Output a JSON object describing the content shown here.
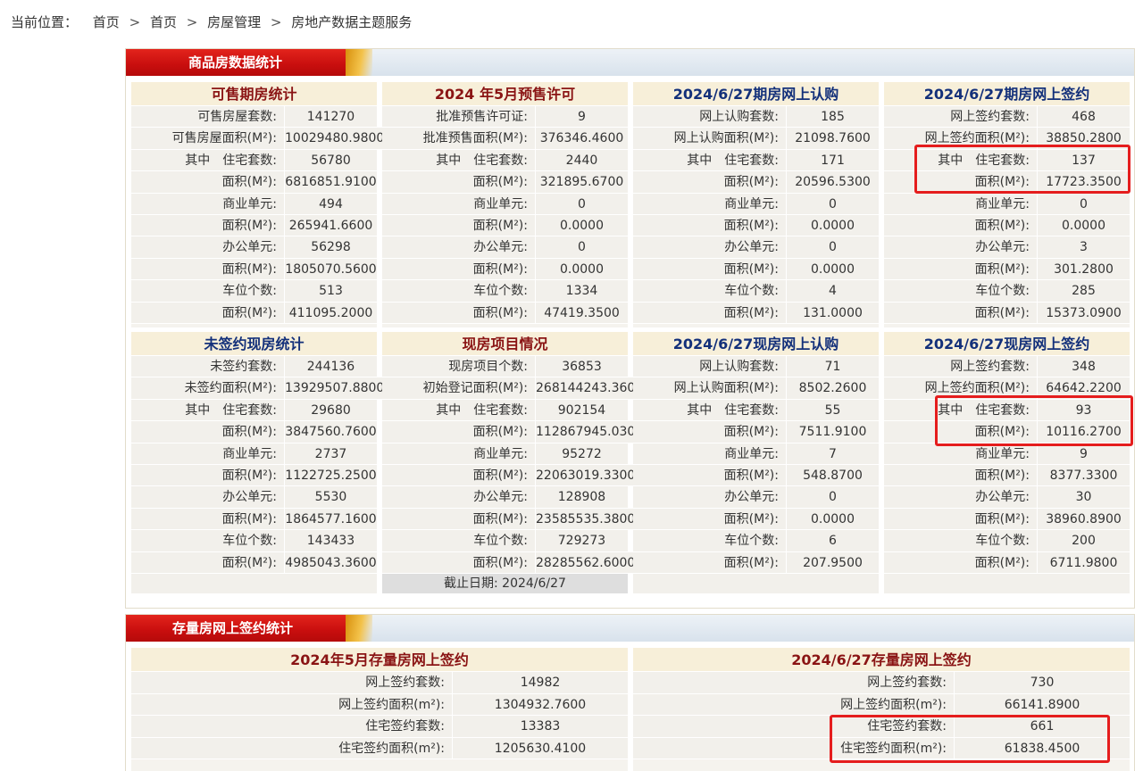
{
  "breadcrumb": {
    "label": "当前位置：",
    "items": [
      "首页",
      "首页",
      "房屋管理",
      "房地产数据主题服务"
    ]
  },
  "section1": {
    "title": "商品房数据统计",
    "blocks": [
      {
        "title": "可售期房统计",
        "rows": [
          {
            "label": "可售房屋套数:",
            "value": "141270"
          },
          {
            "label": "可售房屋面积(M²):",
            "value": "10029480.9800"
          },
          {
            "prefix": "其中",
            "label": "住宅套数:",
            "value": "56780"
          },
          {
            "label": "面积(M²):",
            "value": "6816851.9100"
          },
          {
            "label": "商业单元:",
            "value": "494"
          },
          {
            "label": "面积(M²):",
            "value": "265941.6600"
          },
          {
            "label": "办公单元:",
            "value": "56298"
          },
          {
            "label": "面积(M²):",
            "value": "1805070.5600"
          },
          {
            "label": "车位个数:",
            "value": "513"
          },
          {
            "label": "面积(M²):",
            "value": "411095.2000"
          }
        ]
      },
      {
        "title": "2024 年5月预售许可",
        "rows": [
          {
            "label": "批准预售许可证:",
            "value": "9"
          },
          {
            "label": "批准预售面积(M²):",
            "value": "376346.4600"
          },
          {
            "prefix": "其中",
            "label": "住宅套数:",
            "value": "2440"
          },
          {
            "label": "面积(M²):",
            "value": "321895.6700"
          },
          {
            "label": "商业单元:",
            "value": "0"
          },
          {
            "label": "面积(M²):",
            "value": "0.0000"
          },
          {
            "label": "办公单元:",
            "value": "0"
          },
          {
            "label": "面积(M²):",
            "value": "0.0000"
          },
          {
            "label": "车位个数:",
            "value": "1334"
          },
          {
            "label": "面积(M²):",
            "value": "47419.3500"
          }
        ]
      },
      {
        "title": "2024/6/27期房网上认购",
        "rows": [
          {
            "label": "网上认购套数:",
            "value": "185"
          },
          {
            "label": "网上认购面积(M²):",
            "value": "21098.7600"
          },
          {
            "prefix": "其中",
            "label": "住宅套数:",
            "value": "171"
          },
          {
            "label": "面积(M²):",
            "value": "20596.5300"
          },
          {
            "label": "商业单元:",
            "value": "0"
          },
          {
            "label": "面积(M²):",
            "value": "0.0000"
          },
          {
            "label": "办公单元:",
            "value": "0"
          },
          {
            "label": "面积(M²):",
            "value": "0.0000"
          },
          {
            "label": "车位个数:",
            "value": "4"
          },
          {
            "label": "面积(M²):",
            "value": "131.0000"
          }
        ]
      },
      {
        "title": "2024/6/27期房网上签约",
        "rows": [
          {
            "label": "网上签约套数:",
            "value": "468"
          },
          {
            "label": "网上签约面积(M²):",
            "value": "38850.2800"
          },
          {
            "prefix": "其中",
            "label": "住宅套数:",
            "value": "137"
          },
          {
            "label": "面积(M²):",
            "value": "17723.3500"
          },
          {
            "label": "商业单元:",
            "value": "0"
          },
          {
            "label": "面积(M²):",
            "value": "0.0000"
          },
          {
            "label": "办公单元:",
            "value": "3"
          },
          {
            "label": "面积(M²):",
            "value": "301.2800"
          },
          {
            "label": "车位个数:",
            "value": "285"
          },
          {
            "label": "面积(M²):",
            "value": "15373.0900"
          }
        ]
      },
      {
        "title": "未签约现房统计",
        "rows": [
          {
            "label": "未签约套数:",
            "value": "244136"
          },
          {
            "label": "未签约面积(M²):",
            "value": "13929507.8800"
          },
          {
            "prefix": "其中",
            "label": "住宅套数:",
            "value": "29680"
          },
          {
            "label": "面积(M²):",
            "value": "3847560.7600"
          },
          {
            "label": "商业单元:",
            "value": "2737"
          },
          {
            "label": "面积(M²):",
            "value": "1122725.2500"
          },
          {
            "label": "办公单元:",
            "value": "5530"
          },
          {
            "label": "面积(M²):",
            "value": "1864577.1600"
          },
          {
            "label": "车位个数:",
            "value": "143433"
          },
          {
            "label": "面积(M²):",
            "value": "4985043.3600"
          }
        ]
      },
      {
        "title": "现房项目情况",
        "rows": [
          {
            "label": "现房项目个数:",
            "value": "36853"
          },
          {
            "label": "初始登记面积(M²):",
            "value": "268144243.3600"
          },
          {
            "prefix": "其中",
            "label": "住宅套数:",
            "value": "902154"
          },
          {
            "label": "面积(M²):",
            "value": "112867945.0300"
          },
          {
            "label": "商业单元:",
            "value": "95272"
          },
          {
            "label": "面积(M²):",
            "value": "22063019.3300"
          },
          {
            "label": "办公单元:",
            "value": "128908"
          },
          {
            "label": "面积(M²):",
            "value": "23585535.3800"
          },
          {
            "label": "车位个数:",
            "value": "729273"
          },
          {
            "label": "面积(M²):",
            "value": "28285562.6000"
          }
        ],
        "footer": "截止日期:  2024/6/27"
      },
      {
        "title": "2024/6/27现房网上认购",
        "rows": [
          {
            "label": "网上认购套数:",
            "value": "71"
          },
          {
            "label": "网上认购面积(M²):",
            "value": "8502.2600"
          },
          {
            "prefix": "其中",
            "label": "住宅套数:",
            "value": "55"
          },
          {
            "label": "面积(M²):",
            "value": "7511.9100"
          },
          {
            "label": "商业单元:",
            "value": "7"
          },
          {
            "label": "面积(M²):",
            "value": "548.8700"
          },
          {
            "label": "办公单元:",
            "value": "0"
          },
          {
            "label": "面积(M²):",
            "value": "0.0000"
          },
          {
            "label": "车位个数:",
            "value": "6"
          },
          {
            "label": "面积(M²):",
            "value": "207.9500"
          }
        ]
      },
      {
        "title": "2024/6/27现房网上签约",
        "rows": [
          {
            "label": "网上签约套数:",
            "value": "348"
          },
          {
            "label": "网上签约面积(M²):",
            "value": "64642.2200"
          },
          {
            "prefix": "其中",
            "label": "住宅套数:",
            "value": "93"
          },
          {
            "label": "面积(M²):",
            "value": "10116.2700"
          },
          {
            "label": "商业单元:",
            "value": "9"
          },
          {
            "label": "面积(M²):",
            "value": "8377.3300"
          },
          {
            "label": "办公单元:",
            "value": "30"
          },
          {
            "label": "面积(M²):",
            "value": "38960.8900"
          },
          {
            "label": "车位个数:",
            "value": "200"
          },
          {
            "label": "面积(M²):",
            "value": "6711.9800"
          }
        ]
      }
    ]
  },
  "section2": {
    "title": "存量房网上签约统计",
    "blocks": [
      {
        "title": "2024年5月存量房网上签约",
        "rows": [
          {
            "label": "网上签约套数:",
            "value": "14982"
          },
          {
            "label": "网上签约面积(m²):",
            "value": "1304932.7600"
          },
          {
            "label": "住宅签约套数:",
            "value": "13383"
          },
          {
            "label": "住宅签约面积(m²):",
            "value": "1205630.4100"
          }
        ]
      },
      {
        "title": "2024/6/27存量房网上签约",
        "rows": [
          {
            "label": "网上签约套数:",
            "value": "730"
          },
          {
            "label": "网上签约面积(m²):",
            "value": "66141.8900"
          },
          {
            "label": "住宅签约套数:",
            "value": "661"
          },
          {
            "label": "住宅签约面积(m²):",
            "value": "61838.4500"
          }
        ]
      }
    ]
  },
  "colors": {
    "title_red": "#c80e0e",
    "header_red_text": "#8a1414",
    "header_blue_text": "#13307a",
    "highlight": "#e51d1d"
  }
}
